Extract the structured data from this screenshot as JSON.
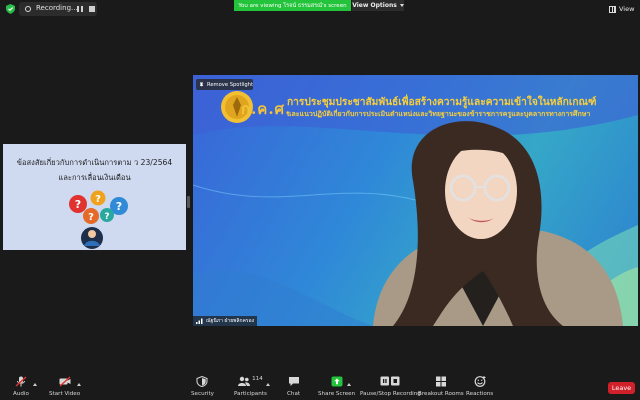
{
  "top_bar": {
    "recording_label": "Recording...",
    "viewing_banner": "You are viewing โรจน์ ธรรมสรณ์'s screen",
    "view_options_label": "View Options",
    "view_label": "View",
    "banner_color": "#23c43b"
  },
  "thumbnail": {
    "line1": "ข้อสงสัยเกี่ยวกับการดำเนินการตาม ว 23/2564",
    "line2": "และการเลื่อนเงินเดือน",
    "background": "#cfd9f0"
  },
  "main_video": {
    "spotlight_badge": "Remove Spotlight",
    "brand": "ก.ค.ศ.",
    "title_line1": "การประชุมประชาสัมพันธ์เพื่อสร้างความรู้และความเข้าใจในหลักเกณฑ์",
    "title_line2": "และแนวปฏิบัติเกี่ยวกับการประเมินตำแหน่งและวิทยฐานะของข้าราชการครูและบุคลากรทางการศึกษา",
    "participant_name": "ณัฐนิภา ฝ่ายพลิกครอง"
  },
  "toolbar": {
    "audio": "Audio",
    "start_video": "Start Video",
    "security": "Security",
    "participants": "Participants",
    "participants_count": "114",
    "chat": "Chat",
    "share_screen": "Share Screen",
    "recording": "Pause/Stop Recording",
    "breakout_rooms": "Breakout Rooms",
    "reactions": "Reactions",
    "leave": "Leave",
    "leave_color": "#d0202a",
    "share_color": "#23c43b"
  }
}
